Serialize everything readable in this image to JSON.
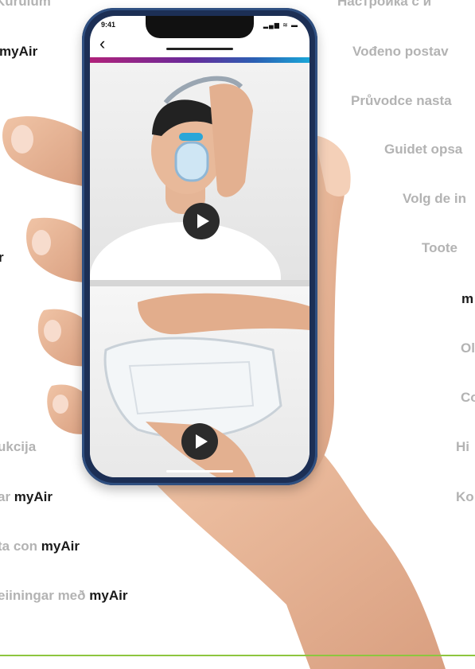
{
  "left_labels": [
    {
      "gray": "Kurulum",
      "dark": ""
    },
    {
      "gray": "",
      "dark": "myAir"
    },
    {
      "gray": "",
      "dark": "r"
    },
    {
      "gray": "ukcija",
      "dark": ""
    },
    {
      "gray": "ar ",
      "dark": "myAir"
    },
    {
      "gray": "ta con ",
      "dark": "myAir"
    },
    {
      "gray": "eiiningar með ",
      "dark": "myAir"
    }
  ],
  "right_labels": [
    {
      "gray": "Настройка с и",
      "dark": ""
    },
    {
      "gray": "Vođeno postav",
      "dark": ""
    },
    {
      "gray": "Průvodce nasta",
      "dark": ""
    },
    {
      "gray": "Guidet opsa",
      "dark": ""
    },
    {
      "gray": "Volg de in",
      "dark": ""
    },
    {
      "gray": "Toote",
      "dark": ""
    },
    {
      "gray": "",
      "dark": "m"
    },
    {
      "gray": "Ol",
      "dark": ""
    },
    {
      "gray": "Co",
      "dark": ""
    },
    {
      "gray": "Hi",
      "dark": ""
    },
    {
      "gray": "Ko",
      "dark": ""
    }
  ],
  "phone": {
    "status_time": "9:41",
    "status_icons": "▂▄▆ ≋ ▬",
    "back_icon": "back-chevron-icon",
    "video_1": {
      "subject": "man fitting CPAP mask",
      "play_icon": "play-icon"
    },
    "video_2": {
      "subject": "hands holding mask components",
      "play_icon": "play-icon"
    }
  },
  "colors": {
    "gray_text": "#b3b3b3",
    "dark_text": "#1a1a1a",
    "phone_frame": "#1c2f55",
    "gradient": [
      "#b0227a",
      "#6a2a9a",
      "#2b5fb3",
      "#1aa6d8"
    ],
    "rule": "#8dc63f",
    "skin": "#e7b596"
  }
}
